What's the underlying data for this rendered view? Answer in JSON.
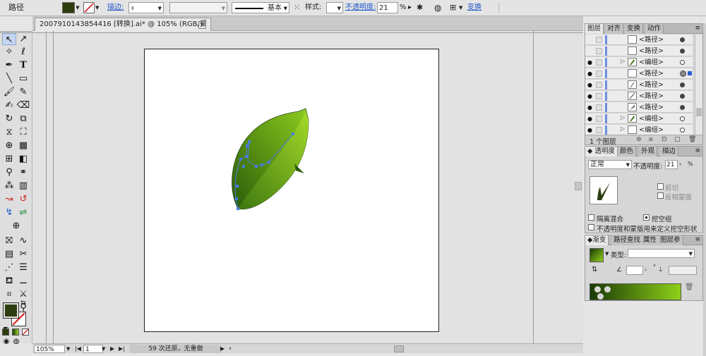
{
  "control_bar": {
    "object_type": "路径",
    "fill_color": "#2e3d10",
    "stroke_label": "描边:",
    "stroke_weight": "",
    "stroke_profile": "基本",
    "style_label": "样式:",
    "opacity_label": "不透明度:",
    "opacity_value": "21",
    "percent": "%",
    "transform_label": "变换"
  },
  "document": {
    "tab_title": "2007910143854416 [转换].ai* @ 105% (RGB/预览)"
  },
  "status_bar": {
    "zoom": "105%",
    "artboard": "1",
    "history": "59 次还原，无重做"
  },
  "layers_panel": {
    "tabs": [
      "图层",
      "对齐",
      "变换",
      "动作"
    ],
    "rows": [
      {
        "name": "<路径>",
        "visible": false,
        "expand": false,
        "target": "filled"
      },
      {
        "name": "<路径>",
        "visible": false,
        "expand": false,
        "target": "filled"
      },
      {
        "name": "<编组>",
        "visible": true,
        "expand": true,
        "target": "hollow"
      },
      {
        "name": "<路径>",
        "visible": true,
        "expand": false,
        "target": "selected"
      },
      {
        "name": "<路径>",
        "visible": true,
        "expand": false,
        "target": "filled"
      },
      {
        "name": "<路径>",
        "visible": true,
        "expand": false,
        "target": "filled"
      },
      {
        "name": "<路径>",
        "visible": true,
        "expand": false,
        "target": "filled"
      },
      {
        "name": "<编组>",
        "visible": true,
        "expand": true,
        "target": "hollow"
      },
      {
        "name": "<编组>",
        "visible": true,
        "expand": true,
        "target": "hollow"
      }
    ],
    "layer_count": "1 个图层"
  },
  "transparency_panel": {
    "tabs": [
      "透明度",
      "颜色",
      "外观",
      "描边"
    ],
    "blend_mode": "正常",
    "opacity_label": "不透明度:",
    "opacity_value": "21",
    "percent": "%",
    "clip_label": "剪切",
    "invert_mask_label": "反相蒙版",
    "isolate_blending": "隔离混合",
    "knockout_group": "挖空组",
    "opacity_mask_knockout": "不透明度和蒙版用来定义挖空形状"
  },
  "gradient_panel": {
    "tabs": [
      "渐变",
      "路径查找",
      "属性",
      "图层参"
    ],
    "type_label": "类型:",
    "type_value": "",
    "angle_value": "",
    "ratio_value": "",
    "degree": "°",
    "color_start": "#1a3a05",
    "color_end": "#8fd11a"
  },
  "colors": {
    "accent": "#1f55c9",
    "leaf_dark": "#2e5a0c",
    "leaf_light": "#8cc820",
    "anchor": "#4a7be6"
  }
}
